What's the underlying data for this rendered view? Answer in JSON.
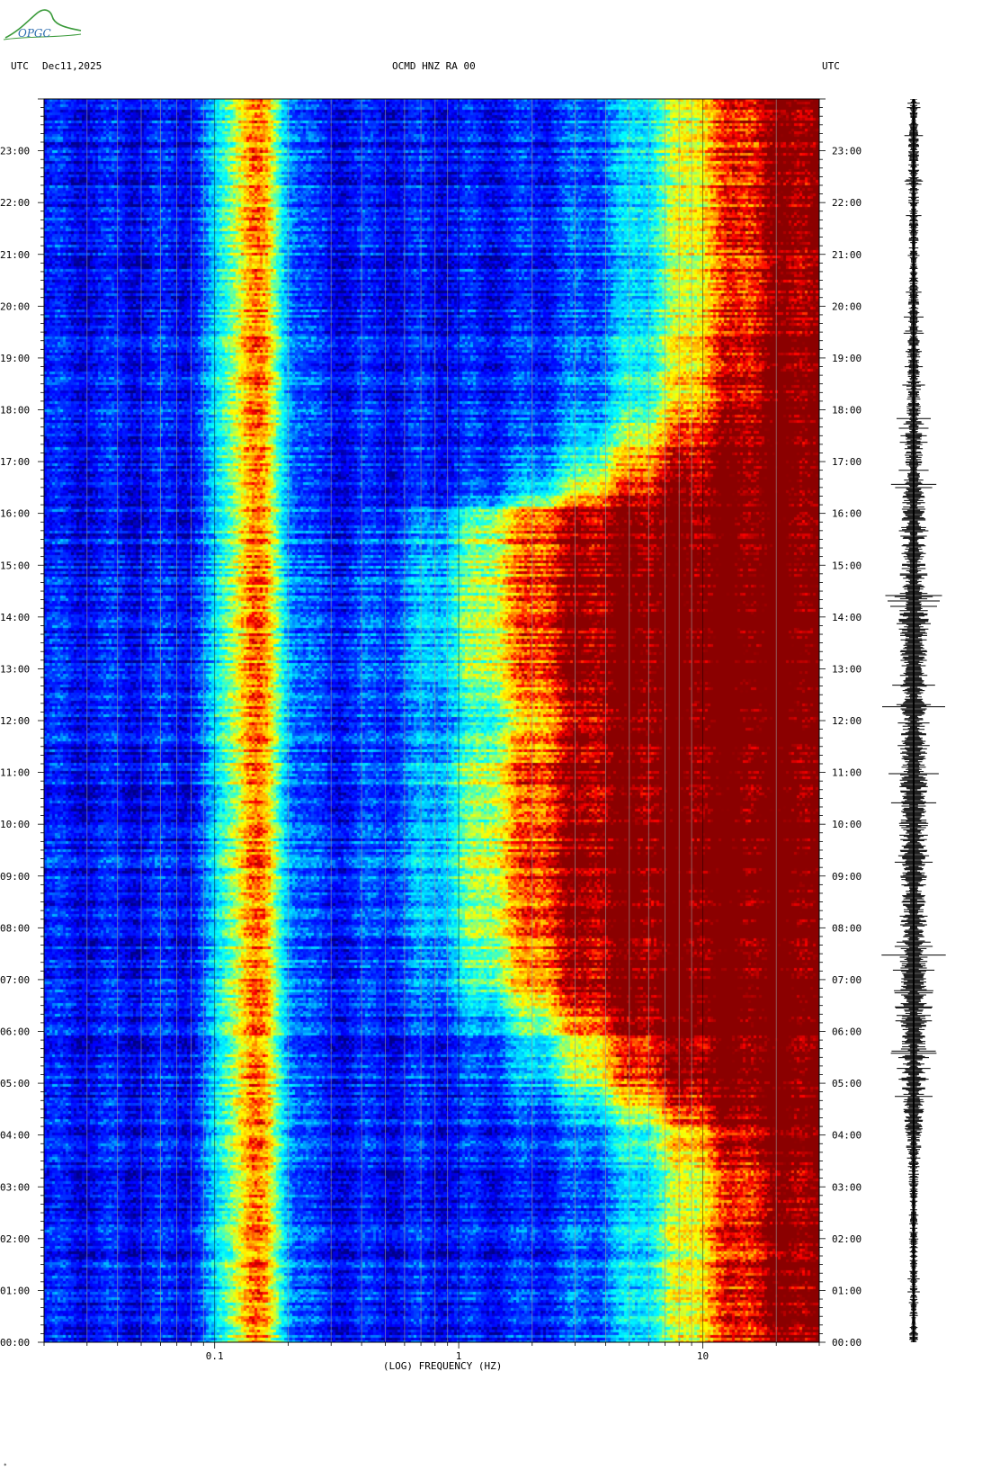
{
  "header": {
    "left_tz": "UTC",
    "date": "Dec11,2025",
    "station": "OCMD HNZ RA 00",
    "right_tz": "UTC"
  },
  "logo": {
    "text": "OPGC",
    "icon": "opgc-logo-icon"
  },
  "chart_data": {
    "type": "heatmap",
    "title": "OCMD HNZ RA 00",
    "xlabel": "(LOG) FREQUENCY (HZ)",
    "ylabel": "",
    "x_scale": "log",
    "xlim": [
      0.02,
      30
    ],
    "x_ticks": [
      {
        "value": 0.1,
        "label": "0.1"
      },
      {
        "value": 1,
        "label": "1"
      },
      {
        "value": 10,
        "label": "10"
      }
    ],
    "y_axis_unit": "hours UTC",
    "ylim": [
      0,
      24
    ],
    "y_ticks": [
      "00:00",
      "01:00",
      "02:00",
      "03:00",
      "04:00",
      "05:00",
      "06:00",
      "07:00",
      "08:00",
      "09:00",
      "10:00",
      "11:00",
      "12:00",
      "13:00",
      "14:00",
      "15:00",
      "16:00",
      "17:00",
      "18:00",
      "19:00",
      "20:00",
      "21:00",
      "22:00",
      "23:00"
    ],
    "colormap": [
      "#00008b",
      "#0000ff",
      "#0040ff",
      "#00bfff",
      "#00ffff",
      "#80ff80",
      "#ffff00",
      "#ffa500",
      "#ff0000",
      "#8b0000"
    ],
    "microseism_band_hz": [
      0.1,
      0.2
    ],
    "high_energy_onset_hz_by_hour": [
      [
        0,
        8
      ],
      [
        3,
        8
      ],
      [
        4,
        7
      ],
      [
        5,
        3.5
      ],
      [
        6,
        2.5
      ],
      [
        7,
        1.5
      ],
      [
        8,
        1.3
      ],
      [
        9,
        1.3
      ],
      [
        10,
        1.3
      ],
      [
        11,
        1.2
      ],
      [
        12,
        1.7
      ],
      [
        13,
        1.3
      ],
      [
        14,
        1.3
      ],
      [
        15,
        1.3
      ],
      [
        16,
        1.3
      ],
      [
        16.5,
        3
      ],
      [
        17.5,
        5
      ],
      [
        18,
        7
      ],
      [
        20,
        8
      ],
      [
        24,
        8
      ]
    ],
    "seismogram_amplitude_by_hour": [
      [
        0,
        0.25
      ],
      [
        1,
        0.2
      ],
      [
        2,
        0.22
      ],
      [
        3,
        0.25
      ],
      [
        4,
        0.45
      ],
      [
        5,
        0.65
      ],
      [
        6,
        0.7
      ],
      [
        7,
        0.75
      ],
      [
        8,
        0.75
      ],
      [
        9,
        0.72
      ],
      [
        10,
        0.78
      ],
      [
        11,
        0.75
      ],
      [
        12,
        0.7
      ],
      [
        13,
        0.75
      ],
      [
        14,
        0.8
      ],
      [
        15,
        0.72
      ],
      [
        16,
        0.65
      ],
      [
        17,
        0.5
      ],
      [
        18,
        0.4
      ],
      [
        19,
        0.35
      ],
      [
        20,
        0.3
      ],
      [
        21,
        0.25
      ],
      [
        22,
        0.28
      ],
      [
        23,
        0.3
      ],
      [
        24,
        0.2
      ]
    ]
  }
}
